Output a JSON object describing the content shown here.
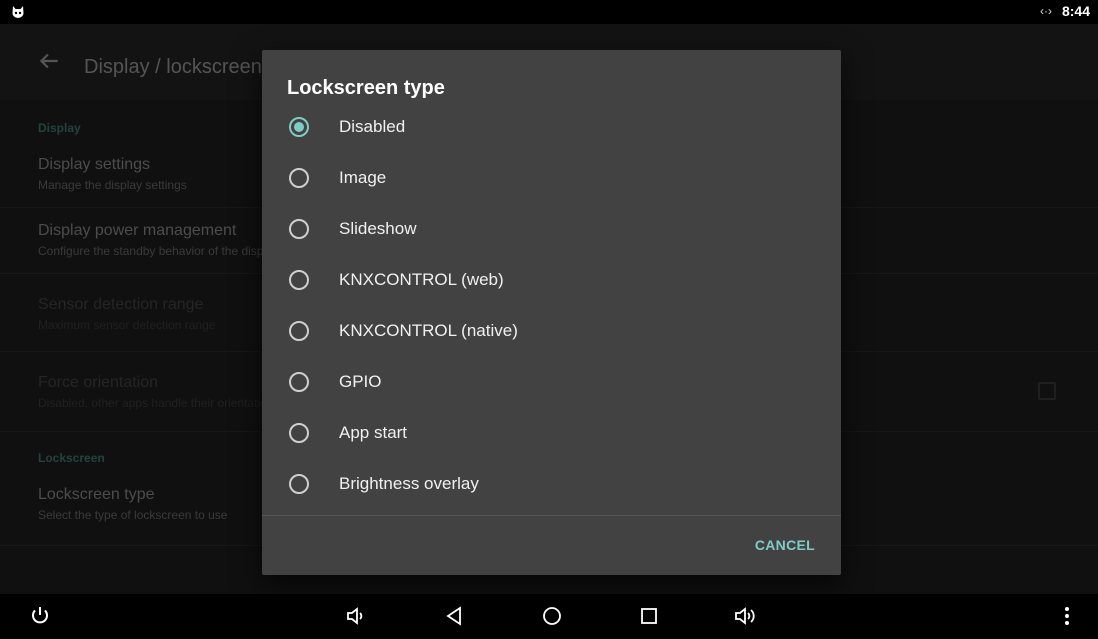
{
  "status_bar": {
    "time": "8:44",
    "network_indicator": "‹·›",
    "app_icon": "android-cat-icon"
  },
  "toolbar": {
    "title": "Display / lockscreen",
    "back_icon": "arrow-left-icon"
  },
  "settings": {
    "display_header": "Display",
    "items": [
      {
        "title": "Display settings",
        "subtitle": "Manage the display settings"
      },
      {
        "title": "Display power management",
        "subtitle": "Configure the standby behavior of the display"
      },
      {
        "title": "Sensor detection range",
        "subtitle": "Maximum sensor detection range"
      },
      {
        "title": "Force orientation",
        "subtitle": "Disabled, other apps handle their orientation"
      }
    ],
    "lockscreen_header": "Lockscreen",
    "lockscreen_item": {
      "title": "Lockscreen type",
      "subtitle": "Select the type of lockscreen to use"
    }
  },
  "dialog": {
    "title": "Lockscreen type",
    "selected": "Disabled",
    "options": [
      "Disabled",
      "Image",
      "Slideshow",
      "KNXCONTROL (web)",
      "KNXCONTROL (native)",
      "GPIO",
      "App start",
      "Brightness overlay"
    ],
    "cancel_label": "CANCEL"
  },
  "nav_bar": {
    "icons": [
      "power-icon",
      "volume-down-icon",
      "back-icon",
      "home-icon",
      "recents-icon",
      "volume-up-icon",
      "more-vert-icon"
    ]
  },
  "colors": {
    "accent": "#80cbc4",
    "dialog_bg": "#424242",
    "section_header": "#3f7a72"
  }
}
